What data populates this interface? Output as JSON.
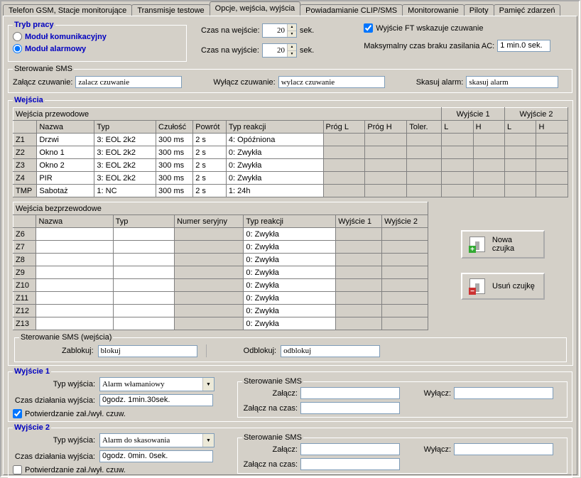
{
  "tabs": {
    "t1": "Telefon GSM, Stacje monitorujące",
    "t2": "Transmisje testowe",
    "t3": "Opcje, wejścia, wyjścia",
    "t4": "Powiadamianie CLIP/SMS",
    "t5": "Monitorowanie",
    "t6": "Piloty",
    "t7": "Pamięć zdarzeń"
  },
  "tryb_pracy": {
    "legend": "Tryb pracy",
    "opt1": "Moduł komunikacyjny",
    "opt2": "Moduł alarmowy"
  },
  "czasy": {
    "we_label": "Czas na wejście:",
    "we_value": "20",
    "we_unit": "sek.",
    "wy_label": "Czas na wyjście:",
    "wy_value": "20",
    "wy_unit": "sek."
  },
  "ft_label": "Wyjście FT wskazuje czuwanie",
  "max_ac_label": "Maksymalny czas braku zasilania AC:",
  "max_ac_value": "1 min.0 sek.",
  "ster_sms": {
    "legend": "Sterowanie SMS",
    "zalacz_l": "Załącz czuwanie:",
    "zalacz_v": "zalacz czuwanie",
    "wylacz_l": "Wyłącz czuwanie:",
    "wylacz_v": "wylacz czuwanie",
    "skasuj_l": "Skasuj alarm:",
    "skasuj_v": "skasuj alarm"
  },
  "wejscia": {
    "legend": "Wejścia",
    "wired_caption": "Wejścia przewodowe",
    "wyj1": "Wyjście 1",
    "wyj2": "Wyjście 2",
    "cols": {
      "nazwa": "Nazwa",
      "typ": "Typ",
      "czul": "Czułość",
      "powrot": "Powrót",
      "reak": "Typ reakcji",
      "progL": "Próg L",
      "progH": "Próg H",
      "tol": "Toler.",
      "L": "L",
      "H": "H"
    },
    "wired_rows": [
      {
        "id": "Z1",
        "nazwa": "Drzwi",
        "typ": "3: EOL 2k2",
        "czul": "300 ms",
        "powrot": "2 s",
        "reak": "4: Opóźniona"
      },
      {
        "id": "Z2",
        "nazwa": "Okno 1",
        "typ": "3: EOL 2k2",
        "czul": "300 ms",
        "powrot": "2 s",
        "reak": "0: Zwykła"
      },
      {
        "id": "Z3",
        "nazwa": "Okno 2",
        "typ": "3: EOL 2k2",
        "czul": "300 ms",
        "powrot": "2 s",
        "reak": "0: Zwykła"
      },
      {
        "id": "Z4",
        "nazwa": "PIR",
        "typ": "3: EOL 2k2",
        "czul": "300 ms",
        "powrot": "2 s",
        "reak": "0: Zwykła"
      },
      {
        "id": "TMP",
        "nazwa": "Sabotaż",
        "typ": "1: NC",
        "czul": "300 ms",
        "powrot": "2 s",
        "reak": "1: 24h"
      }
    ],
    "wireless_caption": "Wejścia bezprzewodowe",
    "cols2": {
      "nazwa": "Nazwa",
      "typ": "Typ",
      "numer": "Numer seryjny",
      "reak": "Typ reakcji",
      "wy1": "Wyjście 1",
      "wy2": "Wyjście 2"
    },
    "wireless_ids": [
      "Z6",
      "Z7",
      "Z8",
      "Z9",
      "Z10",
      "Z11",
      "Z12",
      "Z13"
    ],
    "wireless_reak": "0: Zwykła",
    "btn_add": "Nowa czujka",
    "btn_del": "Usuń czujkę"
  },
  "ster_sms_wejscia": {
    "legend": "Sterowanie SMS (wejścia)",
    "zablokuj_l": "Zablokuj:",
    "zablokuj_v": "blokuj",
    "odblokuj_l": "Odblokuj:",
    "odblokuj_v": "odblokuj"
  },
  "wy1": {
    "legend": "Wyjście 1",
    "typ_l": "Typ wyjścia:",
    "typ_v": "Alarm włamaniowy",
    "czas_l": "Czas działania wyjścia:",
    "czas_v": "0godz. 1min.30sek.",
    "pot_l": "Potwierdzanie zał./wył. czuw.",
    "ster_legend": "Sterowanie SMS",
    "zalacz_l": "Załącz:",
    "wylacz_l": "Wyłącz:",
    "zalacz_czas_l": "Załącz na czas:"
  },
  "wy2": {
    "legend": "Wyjście 2",
    "typ_l": "Typ wyjścia:",
    "typ_v": "Alarm do skasowania",
    "czas_l": "Czas działania wyjścia:",
    "czas_v": "0godz. 0min. 0sek.",
    "pot_l": "Potwierdzanie zał./wył. czuw.",
    "ster_legend": "Sterowanie SMS",
    "zalacz_l": "Załącz:",
    "wylacz_l": "Wyłącz:",
    "zalacz_czas_l": "Załącz na czas:"
  }
}
